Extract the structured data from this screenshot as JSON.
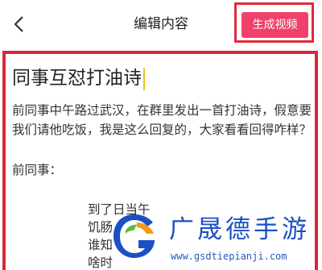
{
  "header": {
    "title": "编辑内容",
    "generate_button": "生成视频",
    "back_icon": "chevron-left-icon"
  },
  "document": {
    "title": "同事互怼打油诗",
    "intro": "前同事中午路过武汉，在群里发出一首打油诗，假意要我们请他吃饭，我是这么回复的，大家看看回得咋样？",
    "sender_label": "前同事：",
    "poem_lines": [
      "到了日当午",
      "饥肠",
      "谁知",
      "啥时"
    ]
  },
  "watermark": {
    "brand_text": "广晟德手游",
    "url": "www.gsdtiepianji.com",
    "logo_colors": {
      "blue": "#1b4fc4",
      "orange": "#f39a1b",
      "green": "#5dbb3a"
    }
  },
  "colors": {
    "accent": "#f0416a",
    "highlight_border": "#e02a3c",
    "cursor": "#e5c41b"
  }
}
